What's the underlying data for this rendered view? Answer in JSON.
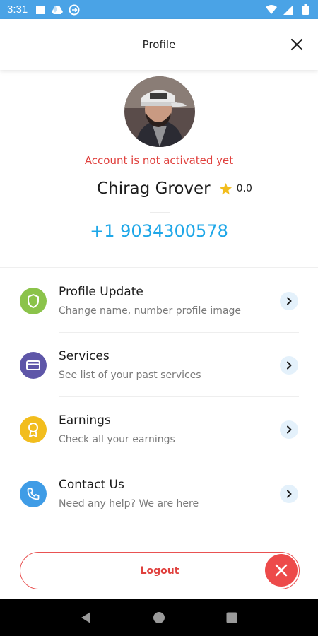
{
  "status_bar": {
    "time": "3:31",
    "icons_left": [
      "square-icon",
      "drive-icon",
      "sync-icon"
    ],
    "icons_right": [
      "wifi-icon",
      "signal-icon",
      "battery-icon"
    ]
  },
  "header": {
    "title": "Profile",
    "close_icon": "close-icon"
  },
  "profile": {
    "status": "Account is not activated yet",
    "name": "Chirag Grover",
    "rating": "0.0",
    "phone": "+1 9034300578"
  },
  "menu": {
    "items": [
      {
        "title": "Profile Update",
        "subtitle": "Change name, number profile image",
        "icon": "shield-icon",
        "color": "#8bc34a"
      },
      {
        "title": "Services",
        "subtitle": "See list of your past services",
        "icon": "card-icon",
        "color": "#5e56a8"
      },
      {
        "title": "Earnings",
        "subtitle": "Check all your earnings",
        "icon": "award-icon",
        "color": "#f2bd1d"
      },
      {
        "title": "Contact Us",
        "subtitle": "Need any help? We are here",
        "icon": "phone-icon",
        "color": "#3f9ce6"
      }
    ]
  },
  "logout": {
    "label": "Logout",
    "icon": "close-circle-icon"
  },
  "colors": {
    "accent": "#4aa3e6",
    "error": "#e0413e",
    "phone": "#1ea7e8",
    "star": "#f2bd1d"
  }
}
